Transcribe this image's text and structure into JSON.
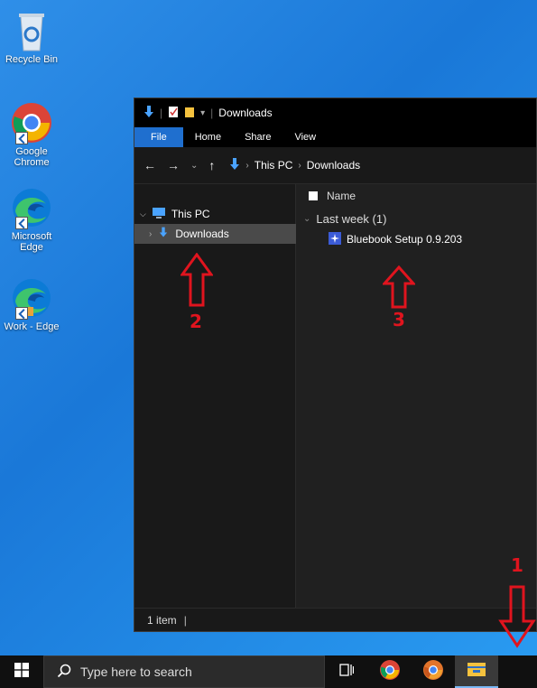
{
  "desktop": {
    "icons": [
      {
        "label": "Recycle Bin"
      },
      {
        "label": "Google Chrome"
      },
      {
        "label": "Microsoft Edge"
      },
      {
        "label": "Work - Edge"
      }
    ]
  },
  "explorer": {
    "title": "Downloads",
    "ribbon_tabs": [
      "File",
      "Home",
      "Share",
      "View"
    ],
    "breadcrumb": [
      "This PC",
      "Downloads"
    ],
    "tree": {
      "root": "This PC",
      "selected": "Downloads"
    },
    "column_header": "Name",
    "group_label": "Last week (1)",
    "files": [
      {
        "name": "Bluebook Setup 0.9.203"
      }
    ],
    "status": "1 item"
  },
  "annotations": {
    "step1": "1",
    "step2": "2",
    "step3": "3",
    "color": "#e0141e"
  },
  "taskbar": {
    "search_placeholder": "Type here to search"
  },
  "colors": {
    "desktop_bg": "#1a78d8",
    "accent": "#1f6fcf",
    "window_bg": "#191919"
  }
}
